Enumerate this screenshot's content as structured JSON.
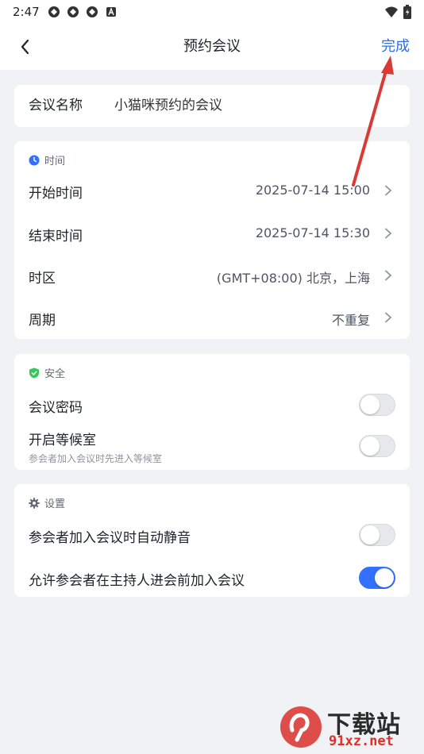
{
  "status": {
    "time": "2:47",
    "icons": [
      "sync-icon",
      "sync-icon",
      "sync-icon",
      "a-icon"
    ],
    "right_icons": [
      "wifi-icon",
      "battery-icon"
    ]
  },
  "nav": {
    "title": "预约会议",
    "done_label": "完成",
    "back_icon": "chevron-left-icon"
  },
  "meeting_name": {
    "label": "会议名称",
    "value": "小猫咪预约的会议"
  },
  "time_section": {
    "header": "时间",
    "icon": "clock-icon",
    "rows": [
      {
        "label": "开始时间",
        "value": "2025-07-14 15:00"
      },
      {
        "label": "结束时间",
        "value": "2025-07-14 15:30"
      },
      {
        "label": "时区",
        "value": "(GMT+08:00) 北京，上海"
      },
      {
        "label": "周期",
        "value": "不重复"
      }
    ]
  },
  "security_section": {
    "header": "安全",
    "icon": "shield-check-icon",
    "password_label": "会议密码",
    "password_on": false,
    "waiting_label": "开启等候室",
    "waiting_sub": "参会者加入会议时先进入等候室",
    "waiting_on": false
  },
  "settings_section": {
    "header": "设置",
    "icon": "gear-icon",
    "mute_label": "参会者加入会议时自动静音",
    "mute_on": false,
    "early_join_label": "允许参会者在主持人进会前加入会议",
    "early_join_on": true
  },
  "colors": {
    "accent": "#3370ff",
    "link": "#2f6fe0",
    "annotation_arrow": "#d93a35",
    "background": "#f1f2f5"
  },
  "watermark": {
    "brand": "下载站",
    "url": "91xz.net"
  }
}
